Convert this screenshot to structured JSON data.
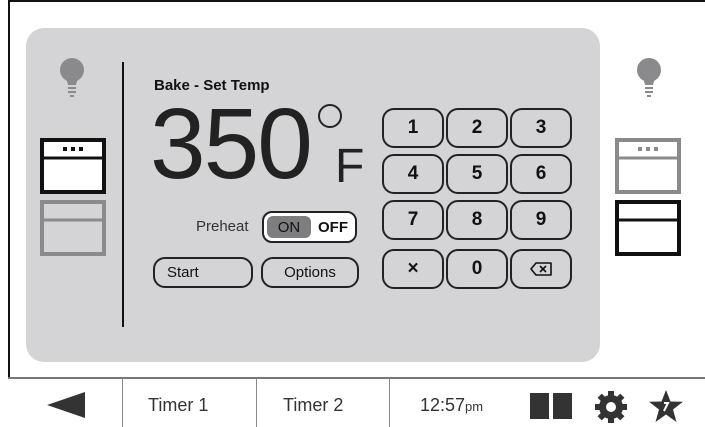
{
  "main": {
    "title": "Bake - Set Temp",
    "temperature": "350",
    "unit": "F",
    "preheat_label": "Preheat",
    "toggle_on": "ON",
    "toggle_off": "OFF",
    "start_label": "Start",
    "options_label": "Options"
  },
  "keypad": {
    "keys": [
      "1",
      "2",
      "3",
      "4",
      "5",
      "6",
      "7",
      "8",
      "9",
      "×",
      "0"
    ],
    "backspace_icon": "backspace-icon"
  },
  "bottom_bar": {
    "timer1": "Timer 1",
    "timer2": "Timer 2",
    "time": "12:57",
    "time_suffix": "pm"
  },
  "colors": {
    "panel": "#d4d3d5",
    "toggle_active": "#7e7d7f",
    "icon_gray": "#8a898b",
    "text_dark": "#111111"
  },
  "icons": [
    "light-bulb-icon",
    "oven-upper-icon",
    "oven-lower-icon",
    "back-arrow-icon",
    "split-view-icon",
    "gear-icon",
    "favorites-star-icon"
  ]
}
